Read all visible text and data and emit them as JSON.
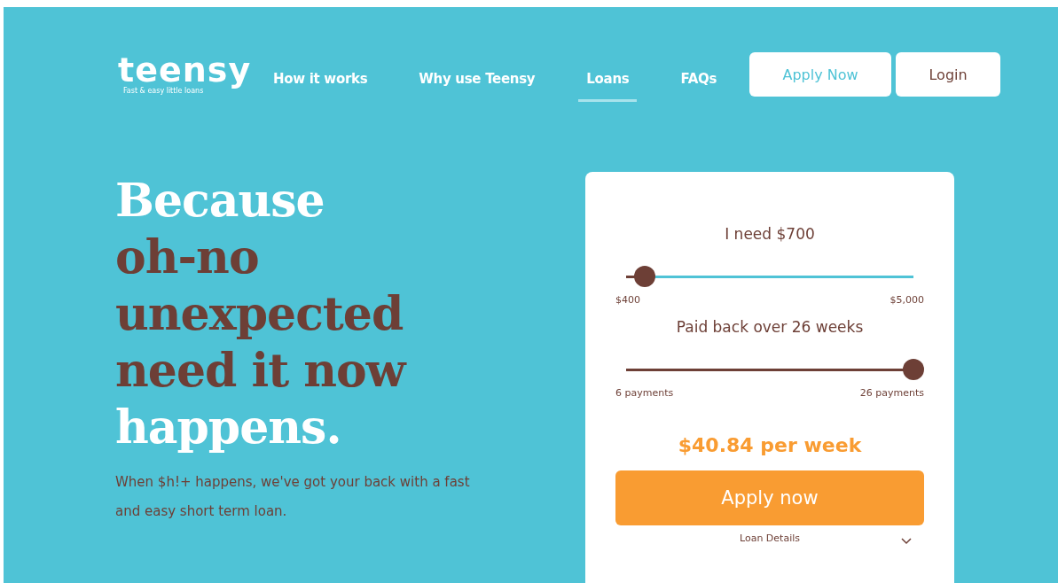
{
  "logo": {
    "name": "teensy",
    "tagline": "Fast & easy little loans"
  },
  "nav": [
    {
      "label": "How it works",
      "selected": false
    },
    {
      "label": "Why use Teensy",
      "selected": false
    },
    {
      "label": "Loans",
      "selected": true
    },
    {
      "label": "FAQs",
      "selected": false
    }
  ],
  "header_buttons": [
    {
      "label": "Apply Now",
      "kind": "accent"
    },
    {
      "label": "Login",
      "kind": "plain"
    }
  ],
  "headline": [
    {
      "text": "Because",
      "kind": "light"
    },
    {
      "text": "oh-no",
      "kind": "accent"
    },
    {
      "text": "unexpected",
      "kind": "accent"
    },
    {
      "text": "need it now",
      "kind": "accent"
    },
    {
      "text": "happens.",
      "kind": "light"
    }
  ],
  "intro": "When $h!+ happens, we've got your back with a fast and easy short term loan.",
  "calculator": {
    "sliders": [
      {
        "label": "I need $700",
        "level": 0.065,
        "min_label": "$400",
        "max_label": "$5,000"
      },
      {
        "label": "Paid back over 26 weeks",
        "level": 1,
        "min_label": "6 payments",
        "max_label": "26 payments"
      }
    ],
    "repayment": "$40.84 per week",
    "button": "Apply now",
    "details": "Loan Details"
  }
}
